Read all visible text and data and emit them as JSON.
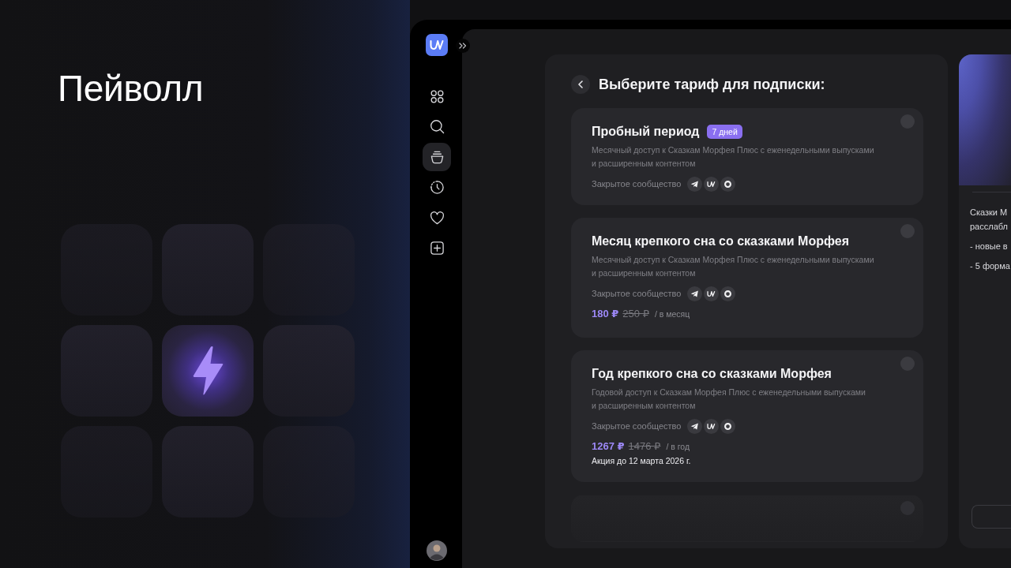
{
  "headline": "Пейволл",
  "showcase_tiles": [
    {
      "highlighted": false
    },
    {
      "highlighted": false
    },
    {
      "highlighted": false
    },
    {
      "highlighted": false
    },
    {
      "highlighted": true
    },
    {
      "highlighted": false
    },
    {
      "highlighted": false
    },
    {
      "highlighted": false
    },
    {
      "highlighted": false
    }
  ],
  "sidebar": {
    "nav_items": [
      {
        "selected": false
      },
      {
        "selected": false
      },
      {
        "selected": true
      },
      {
        "selected": false
      },
      {
        "selected": false
      },
      {
        "selected": false
      }
    ]
  },
  "plans_panel": {
    "title": "Выберите тариф для подписки:",
    "plans": [
      {
        "title": "Пробный период",
        "badge": "7 дней",
        "description": "Месячный доступ к Сказкам Морфея Плюс с еженедельными выпусками\nи расширенным контентом",
        "community_label": "Закрытое сообщество",
        "selected": false
      },
      {
        "title": "Месяц крепкого сна со сказками Морфея",
        "description": "Месячный доступ к Сказкам Морфея Плюс с еженедельными выпусками\nи расширенным контентом",
        "community_label": "Закрытое сообщество",
        "price": "180 ₽",
        "old_price": "250 ₽",
        "period": "/ в месяц",
        "selected": false
      },
      {
        "title": "Год крепкого сна со сказками Морфея",
        "description": "Годовой доступ к Сказкам Морфея Плюс с еженедельными выпусками\nи расширенным контентом",
        "community_label": "Закрытое сообщество",
        "price": "1267 ₽",
        "old_price": "1476 ₽",
        "period": "/ в год",
        "promo": "Акция до 12 марта 2026 г.",
        "selected": false
      },
      {
        "selected": false
      }
    ]
  },
  "details_panel": {
    "intro_lines": [
      "Сказки М",
      "расслабл"
    ],
    "bullets": [
      "- новые в",
      "- 5 форма"
    ]
  }
}
